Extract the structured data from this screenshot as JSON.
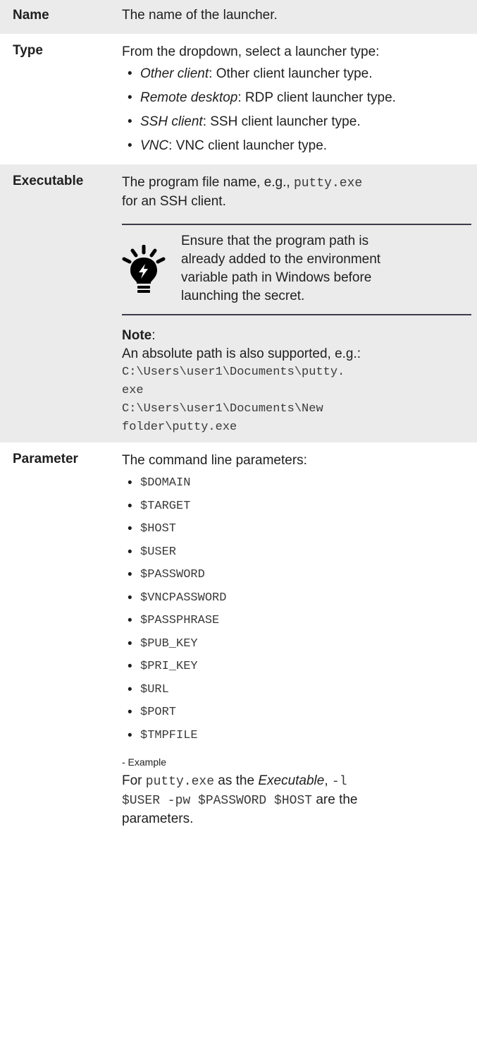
{
  "rows": {
    "name": {
      "key": "Name",
      "desc": "The name of the launcher."
    },
    "type": {
      "key": "Type",
      "intro": "From the dropdown, select a launcher type:",
      "items": [
        {
          "term": "Other client",
          "desc": ": Other client launcher type."
        },
        {
          "term": "Remote desktop",
          "desc": ": RDP client launcher type."
        },
        {
          "term": "SSH client",
          "desc": ": SSH client launcher type."
        },
        {
          "term": "VNC",
          "desc": ": VNC client launcher type."
        }
      ]
    },
    "executable": {
      "key": "Executable",
      "desc_before": "The program file name, e.g., ",
      "desc_code": "putty.exe",
      "desc_after": "for an SSH client.",
      "tip": "Ensure that the program path is already added to the environment variable path in Windows before launching the secret.",
      "note_title": "Note",
      "note_colon": ":",
      "note_text": "An absolute path is also supported, e.g.:",
      "paths": [
        "C:\\Users\\user1\\Documents\\putty.",
        "exe",
        "C:\\Users\\user1\\Documents\\New",
        "folder\\putty.exe"
      ]
    },
    "parameter": {
      "key": "Parameter",
      "intro": "The command line parameters:",
      "items": [
        "$DOMAIN",
        "$TARGET",
        "$HOST",
        "$USER",
        "$PASSWORD",
        "$VNCPASSWORD",
        "$PASSPHRASE",
        "$PUB_KEY",
        "$PRI_KEY",
        "$URL",
        "$PORT",
        "$TMPFILE"
      ],
      "example_label": "- Example",
      "ex_for": "For ",
      "ex_code1": "putty.exe",
      "ex_as": " as the ",
      "ex_em": "Executable",
      "ex_comma": ", ",
      "ex_code2a": "-l",
      "ex_code2b": "$USER -pw $PASSWORD $HOST",
      "ex_after": " are the",
      "ex_end": "parameters."
    }
  },
  "bullet": "•",
  "icon": "lightbulb-icon"
}
